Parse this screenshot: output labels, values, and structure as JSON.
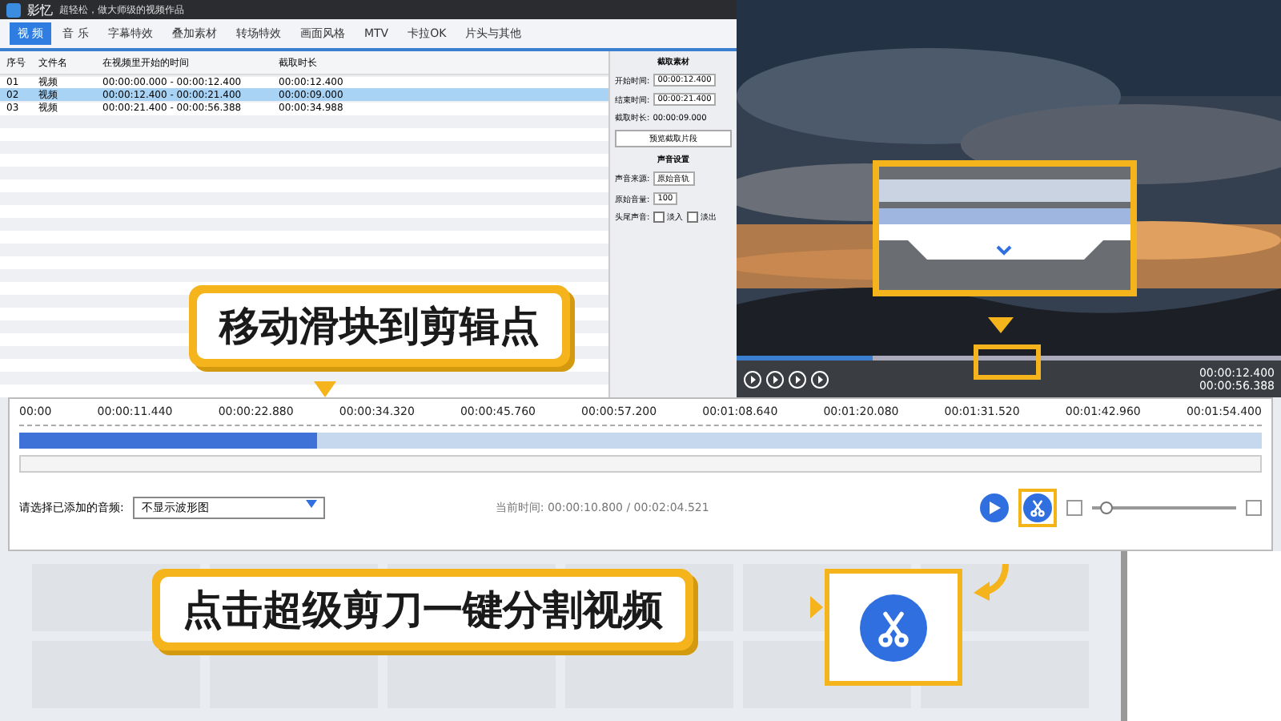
{
  "window": {
    "title": "影忆",
    "subtitle": "超轻松，做大师级的视频作品"
  },
  "tabs": [
    {
      "label": "视 频",
      "selected": true
    },
    {
      "label": "音 乐",
      "selected": false
    },
    {
      "label": "字幕特效",
      "selected": false
    },
    {
      "label": "叠加素材",
      "selected": false
    },
    {
      "label": "转场特效",
      "selected": false
    },
    {
      "label": "画面风格",
      "selected": false
    },
    {
      "label": "MTV",
      "selected": false
    },
    {
      "label": "卡拉OK",
      "selected": false
    },
    {
      "label": "片头与其他",
      "selected": false
    }
  ],
  "table": {
    "columns": [
      "序号",
      "文件名",
      "在视频里开始的时间",
      "截取时长"
    ],
    "rows": [
      {
        "cells": [
          "01",
          "视频",
          "00:00:00.000 - 00:00:12.400",
          "00:00:12.400"
        ],
        "selected": false
      },
      {
        "cells": [
          "02",
          "视频",
          "00:00:12.400 - 00:00:21.400",
          "00:00:09.000"
        ],
        "selected": true
      },
      {
        "cells": [
          "03",
          "视频",
          "00:00:21.400 - 00:00:56.388",
          "00:00:34.988"
        ],
        "selected": false
      }
    ]
  },
  "side_panel": {
    "clip_heading": "截取素材",
    "fields": [
      {
        "label": "开始时间:",
        "value": "00:00:12.400"
      },
      {
        "label": "结束时间:",
        "value": "00:00:21.400"
      }
    ],
    "duration_label": "截取时长:",
    "duration": "00:00:09.000",
    "preview_button": "预览截取片段",
    "sound_heading": "声音设置",
    "source_label": "声音来源:",
    "source_value": "原始音轨",
    "volume_label": "原始音量:",
    "volume_value": "100",
    "fade_label": "头尾声音:",
    "checks": [
      {
        "label": "淡入",
        "checked": false
      },
      {
        "label": "淡出",
        "checked": false
      }
    ]
  },
  "player": {
    "progress": {
      "level": 0.25
    },
    "current_time": "00:00:12.400",
    "total_time": "00:00:56.388"
  },
  "editor": {
    "ticks": [
      "00:00",
      "00:00:11.440",
      "00:00:22.880",
      "00:00:34.320",
      "00:00:45.760",
      "00:00:57.200",
      "00:01:08.640",
      "00:01:20.080",
      "00:01:31.520",
      "00:01:42.960",
      "00:01:54.400"
    ],
    "position": {
      "level": 0.24
    },
    "audio_label": "请选择已添加的音频:",
    "audio_select": "不显示波形图",
    "time_label": "当前时间:",
    "time_value": "00:00:10.800 / 00:02:04.521",
    "zoom": {
      "level": 0.05
    }
  },
  "callouts": [
    {
      "text": "移动滑块到剪辑点"
    },
    {
      "text": "点击超级剪刀一键分割视频"
    }
  ]
}
